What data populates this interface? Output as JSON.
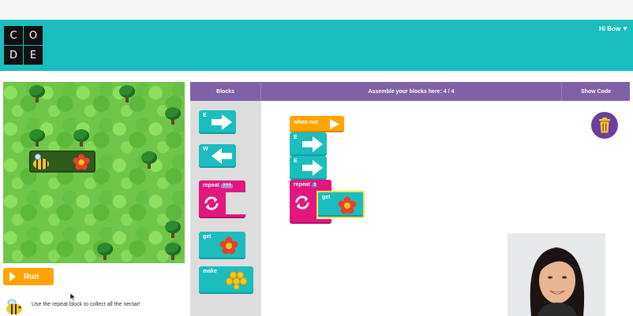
{
  "header": {
    "logo_letters": [
      "C",
      "O",
      "D",
      "E"
    ],
    "greeting": "Hi Bow",
    "menu_caret": "▼",
    "bg_color": "#1bbdbd"
  },
  "maze": {
    "character": "bee-icon",
    "target": "flower-icon"
  },
  "controls": {
    "run_label": "Run",
    "instructions": "Use the repeat block to collect all the nectar!"
  },
  "workspace_header": {
    "blocks_tab": "Blocks",
    "assemble": "Assemble your blocks here: 4 / 4",
    "show_code": "Show Code",
    "bg_color": "#7f61a7"
  },
  "toolbox": {
    "move_east_label": "E",
    "move_west_label": "W",
    "repeat_label": "repeat",
    "repeat_count": "???",
    "get_label": "get",
    "make_label": "make"
  },
  "program": {
    "when_run_label": "when run",
    "move1_label": "E",
    "move2_label": "E",
    "repeat_label": "repeat",
    "repeat_count": "3",
    "get_label": "get"
  },
  "colors": {
    "move_block": "#1bbdbd",
    "repeat_block": "#e2177d",
    "event_block": "#ffa400",
    "run_button": "#ffa400",
    "trash": "#6b3f9c"
  }
}
